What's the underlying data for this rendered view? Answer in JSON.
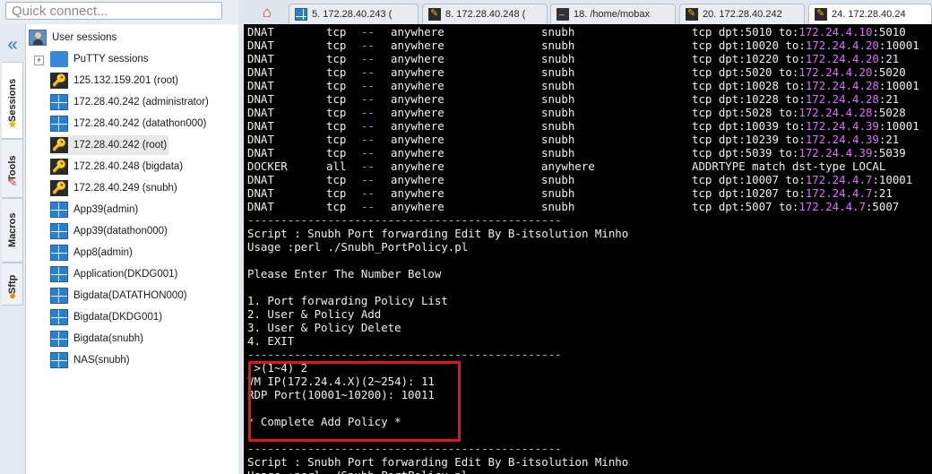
{
  "quick_connect": {
    "placeholder": "Quick connect..."
  },
  "sidebar": {
    "tabs": [
      {
        "label": "Sessions"
      },
      {
        "label": "Tools"
      },
      {
        "label": "Macros"
      },
      {
        "label": "Sftp"
      }
    ]
  },
  "sessions": {
    "root": "User sessions",
    "putty_folder": "PuTTY sessions",
    "items": [
      {
        "label": "125.132.159.201 (root)",
        "icon": "ssh-key-icon"
      },
      {
        "label": "172.28.40.242 (administrator)",
        "icon": "windows-rdp-icon"
      },
      {
        "label": "172.28.40.242 (datathon000)",
        "icon": "windows-rdp-icon"
      },
      {
        "label": "172.28.40.242 (root)",
        "icon": "ssh-key-icon",
        "selected": true
      },
      {
        "label": "172.28.40.248 (bigdata)",
        "icon": "ssh-key-icon"
      },
      {
        "label": "172.28.40.249 (snubh)",
        "icon": "ssh-key-icon"
      },
      {
        "label": "App39(admin)",
        "icon": "windows-rdp-icon"
      },
      {
        "label": "App39(datathon000)",
        "icon": "windows-rdp-icon"
      },
      {
        "label": "App8(admin)",
        "icon": "windows-rdp-icon"
      },
      {
        "label": "Application(DKDG001)",
        "icon": "windows-rdp-icon"
      },
      {
        "label": "Bigdata(DATATHON000)",
        "icon": "windows-rdp-icon"
      },
      {
        "label": "Bigdata(DKDG001)",
        "icon": "windows-rdp-icon"
      },
      {
        "label": "Bigdata(snubh)",
        "icon": "windows-rdp-icon"
      },
      {
        "label": "NAS(snubh)",
        "icon": "windows-rdp-icon"
      }
    ]
  },
  "tabs": [
    {
      "label": "5. 172.28.40.243 ("
    },
    {
      "label": "8. 172.28.40.248 ("
    },
    {
      "label": "18. /home/mobax"
    },
    {
      "label": "20. 172.28.40.242"
    },
    {
      "label": "24. 172.28.40.24"
    }
  ],
  "terminal": {
    "rules": [
      {
        "target": "DNAT",
        "prot": "tcp",
        "opt": "--",
        "src": "anywhere",
        "dst": "snubh",
        "extra": "tcp dpt:5010 to:",
        "ip": "172.24.4.10",
        "port": ":5010"
      },
      {
        "target": "DNAT",
        "prot": "tcp",
        "opt": "--",
        "src": "anywhere",
        "dst": "snubh",
        "extra": "tcp dpt:10020 to:",
        "ip": "172.24.4.20",
        "port": ":10001"
      },
      {
        "target": "DNAT",
        "prot": "tcp",
        "opt": "--",
        "src": "anywhere",
        "dst": "snubh",
        "extra": "tcp dpt:10220 to:",
        "ip": "172.24.4.20",
        "port": ":21"
      },
      {
        "target": "DNAT",
        "prot": "tcp",
        "opt": "--",
        "src": "anywhere",
        "dst": "snubh",
        "extra": "tcp dpt:5020 to:",
        "ip": "172.24.4.20",
        "port": ":5020"
      },
      {
        "target": "DNAT",
        "prot": "tcp",
        "opt": "--",
        "src": "anywhere",
        "dst": "snubh",
        "extra": "tcp dpt:10028 to:",
        "ip": "172.24.4.28",
        "port": ":10001"
      },
      {
        "target": "DNAT",
        "prot": "tcp",
        "opt": "--",
        "src": "anywhere",
        "dst": "snubh",
        "extra": "tcp dpt:10228 to:",
        "ip": "172.24.4.28",
        "port": ":21"
      },
      {
        "target": "DNAT",
        "prot": "tcp",
        "opt": "--",
        "src": "anywhere",
        "dst": "snubh",
        "extra": "tcp dpt:5028 to:",
        "ip": "172.24.4.28",
        "port": ":5028"
      },
      {
        "target": "DNAT",
        "prot": "tcp",
        "opt": "--",
        "src": "anywhere",
        "dst": "snubh",
        "extra": "tcp dpt:10039 to:",
        "ip": "172.24.4.39",
        "port": ":10001"
      },
      {
        "target": "DNAT",
        "prot": "tcp",
        "opt": "--",
        "src": "anywhere",
        "dst": "snubh",
        "extra": "tcp dpt:10239 to:",
        "ip": "172.24.4.39",
        "port": ":21"
      },
      {
        "target": "DNAT",
        "prot": "tcp",
        "opt": "--",
        "src": "anywhere",
        "dst": "snubh",
        "extra": "tcp dpt:5039 to:",
        "ip": "172.24.4.39",
        "port": ":5039"
      },
      {
        "target": "DOCKER",
        "prot": "all",
        "opt": "--",
        "src": "anywhere",
        "dst": "anywhere",
        "extra": "ADDRTYPE match dst-type LOCAL",
        "ip": "",
        "port": ""
      },
      {
        "target": "DNAT",
        "prot": "tcp",
        "opt": "--",
        "src": "anywhere",
        "dst": "snubh",
        "extra": "tcp dpt:10007 to:",
        "ip": "172.24.4.7",
        "port": ":10001"
      },
      {
        "target": "DNAT",
        "prot": "tcp",
        "opt": "--",
        "src": "anywhere",
        "dst": "snubh",
        "extra": "tcp dpt:10207 to:",
        "ip": "172.24.4.7",
        "port": ":21"
      },
      {
        "target": "DNAT",
        "prot": "tcp",
        "opt": "--",
        "src": "anywhere",
        "dst": "snubh",
        "extra": "tcp dpt:5007 to:",
        "ip": "172.24.4.7",
        "port": ":5007"
      }
    ],
    "lines": [
      "-----------------------------------------------",
      "Script : Snubh Port forwarding Edit By B-itsolution Minho",
      "Usage :perl ./Snubh_PortPolicy.pl",
      "",
      "Please Enter The Number Below",
      "",
      "1. Port forwarding Policy List",
      "2. User & Policy Add",
      "3. User & Policy Delete",
      "4. EXIT",
      "-----------------------------------------------",
      " >(1~4) 2",
      "VM IP(172.24.4.X)(2~254): 11",
      "RDP Port(10001~10200): 10011",
      "",
      "* Complete Add Policy *",
      "",
      "-----------------------------------------------",
      "Script : Snubh Port forwarding Edit By B-itsolution Minho",
      "Usage :perl ./Snubh_PortPolicy.pl"
    ]
  },
  "colors": {
    "ip_highlight": "#e070ff",
    "option_dash": "#7aa7ff",
    "annotation_box": "#e3141c"
  }
}
